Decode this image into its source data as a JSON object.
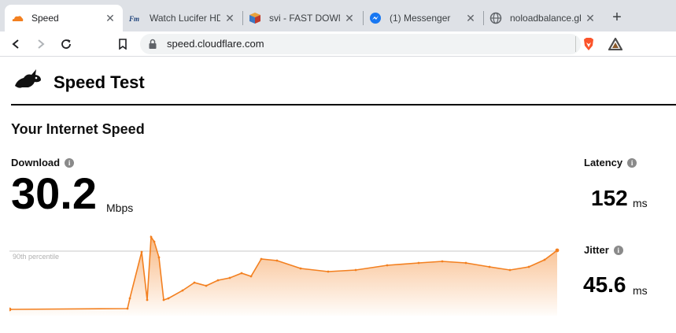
{
  "browser": {
    "tabs": [
      {
        "title": "Speed",
        "icon": "cloudflare-icon",
        "active": true
      },
      {
        "title": "Watch Lucifer HD",
        "icon": "fmovies-icon",
        "active": false
      },
      {
        "title": "svi - FAST DOWNL",
        "icon": "box-icon",
        "active": false
      },
      {
        "title": "(1) Messenger",
        "icon": "messenger-icon",
        "active": false
      },
      {
        "title": "noloadbalance.glo",
        "icon": "globe-icon",
        "active": false
      }
    ],
    "new_tab_label": "+",
    "url": "speed.cloudflare.com"
  },
  "page": {
    "brand_title": "Speed Test",
    "section_title": "Your Internet Speed",
    "download": {
      "label": "Download",
      "value": "30.2",
      "unit": "Mbps"
    },
    "latency": {
      "label": "Latency",
      "value": "152",
      "unit": "ms"
    },
    "jitter": {
      "label": "Jitter",
      "value": "45.6",
      "unit": "ms"
    },
    "info_glyph": "i"
  },
  "chart_data": {
    "type": "area",
    "reference_label": "90th percentile",
    "accent_color": "#f38020",
    "points": [
      [
        0,
        4
      ],
      [
        150,
        5
      ],
      [
        153,
        18
      ],
      [
        168,
        77
      ],
      [
        175,
        16
      ],
      [
        180,
        96
      ],
      [
        184,
        90
      ],
      [
        190,
        70
      ],
      [
        196,
        16
      ],
      [
        202,
        18
      ],
      [
        220,
        28
      ],
      [
        235,
        38
      ],
      [
        250,
        34
      ],
      [
        265,
        41
      ],
      [
        280,
        44
      ],
      [
        295,
        50
      ],
      [
        307,
        46
      ],
      [
        320,
        68
      ],
      [
        340,
        66
      ],
      [
        370,
        56
      ],
      [
        405,
        52
      ],
      [
        440,
        54
      ],
      [
        480,
        60
      ],
      [
        520,
        63
      ],
      [
        550,
        65
      ],
      [
        580,
        63
      ],
      [
        610,
        58
      ],
      [
        636,
        54
      ],
      [
        660,
        58
      ],
      [
        680,
        67
      ],
      [
        696,
        79
      ]
    ],
    "reference_value": 78,
    "y_max": 100
  }
}
